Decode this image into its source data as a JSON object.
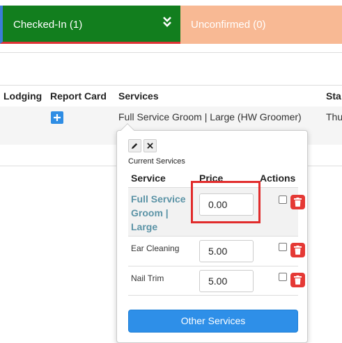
{
  "tabs": {
    "checked_in": "Checked-In (1)",
    "unconfirmed": "Unconfirmed (0)",
    "chevron": "»"
  },
  "table": {
    "columns": [
      "Lodging",
      "Report Card",
      "Services",
      "Sta"
    ],
    "row": {
      "services": "Full Service Groom | Large (HW Groomer)",
      "start": "Thu"
    }
  },
  "popover": {
    "current_label": "Current Services",
    "headers": {
      "service": "Service",
      "price": "Price",
      "actions": "Actions"
    },
    "rows": [
      {
        "service": "Full Service Groom | Large",
        "price": "0.00"
      },
      {
        "service": "Ear Cleaning",
        "price": "5.00"
      },
      {
        "service": "Nail Trim",
        "price": "5.00"
      }
    ],
    "other_services": "Other Services"
  },
  "colors": {
    "checked_tab": "#127e1e",
    "unconfirmed_tab": "#f8b994",
    "primary_button": "#2e8fe8",
    "delete_button": "#e53935",
    "highlight": "#e12b2b"
  }
}
